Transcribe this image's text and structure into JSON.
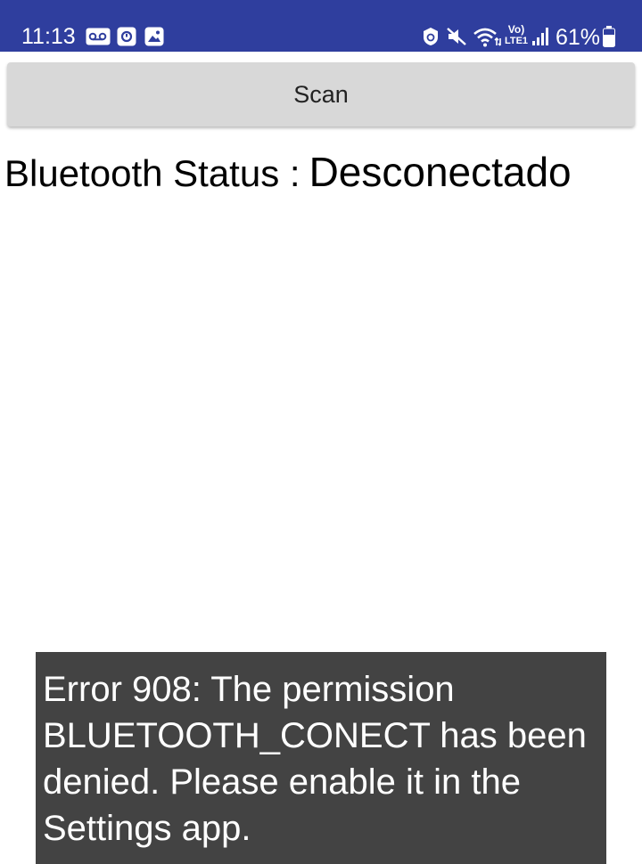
{
  "status_bar": {
    "time": "11:13",
    "battery_percent": "61%",
    "background_color": "#2f3e9e",
    "icons_left": [
      "voicemail-icon",
      "notification-app-icon",
      "gallery-icon"
    ],
    "icons_right": [
      "data-saver-icon",
      "mute-icon",
      "wifi-icon",
      "volte-icon",
      "signal-icon",
      "battery-icon"
    ],
    "volte_text": "Vo)",
    "lte_text": "LTE1"
  },
  "main": {
    "scan_label": "Scan",
    "bluetooth_label": "Bluetooth Status :",
    "bluetooth_status": "Desconectado"
  },
  "toast": {
    "message": "Error 908: The permission BLUETOOTH_CONECT has been denied. Please enable it in the Settings app."
  }
}
